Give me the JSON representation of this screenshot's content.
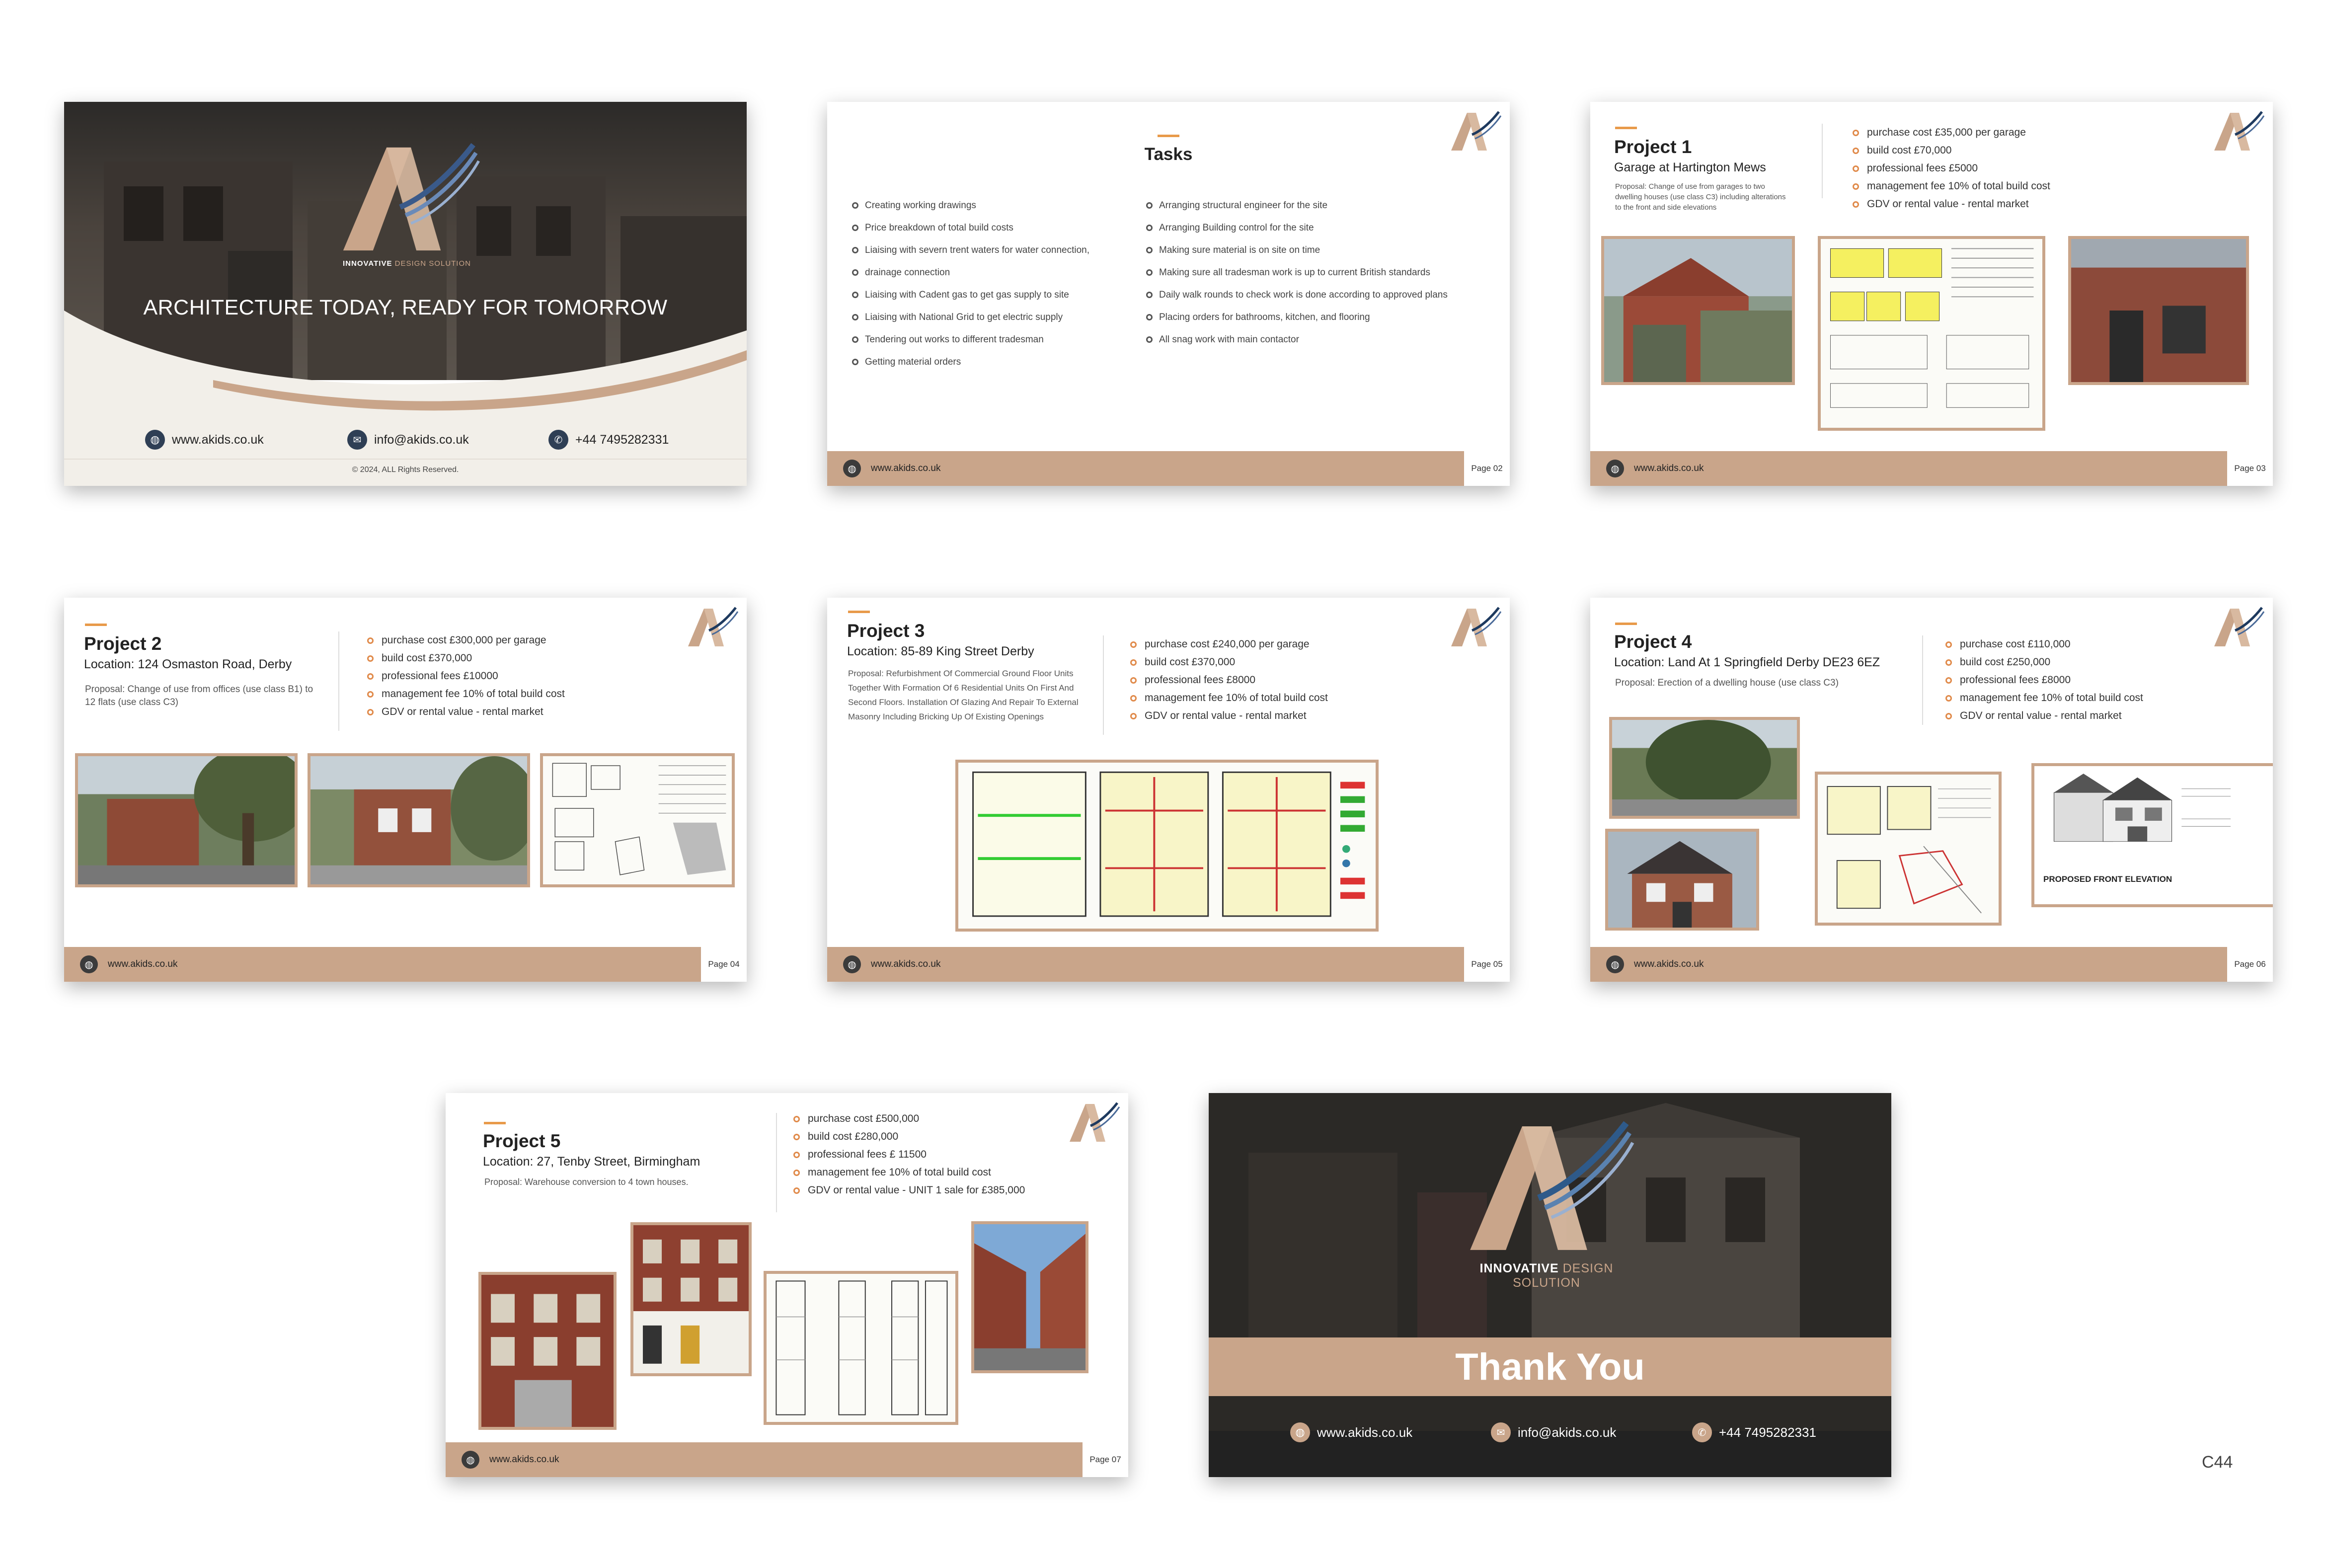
{
  "brand": {
    "name_a": "INNOVATIVE",
    "name_b": "DESIGN SOLUTION",
    "website": "www.akids.co.uk",
    "email": "info@akids.co.uk",
    "phone": "+44 7495282331",
    "colors": {
      "accent": "#c9a58a",
      "navy": "#1e3a5f",
      "orange": "#e89a4a"
    }
  },
  "cover": {
    "headline": "ARCHITECTURE TODAY, READY FOR TOMORROW",
    "copyright": "© 2024, ALL Rights Reserved."
  },
  "tasks": {
    "title": "Tasks",
    "page": "Page 02",
    "left": [
      "Creating working drawings",
      "Price breakdown of total build costs",
      "Liaising with severn trent waters for water connection,",
      "drainage connection",
      "Liaising with Cadent gas to get gas supply to site",
      "Liaising with National Grid to get electric supply",
      "Tendering out works to different tradesman",
      "Getting material orders"
    ],
    "right": [
      "Arranging structural engineer for the site",
      "Arranging Building control for the site",
      "Making sure material is on site on time",
      "Making sure all tradesman work is up to current British standards",
      "Daily walk rounds to check work is done according to approved plans",
      "Placing orders for bathrooms, kitchen, and flooring",
      "All snag work with main contactor"
    ]
  },
  "projects": [
    {
      "title": "Project 1",
      "subtitle": "Garage at Hartington Mews",
      "proposal": "Proposal: Change of use from garages to two dwelling houses (use class C3) including alterations to the front and side elevations",
      "bullets": [
        "purchase cost £35,000 per garage",
        "build cost £70,000",
        "professional fees £5000",
        "management fee 10% of total build cost",
        "GDV or rental value - rental market"
      ],
      "page": "Page 03"
    },
    {
      "title": "Project 2",
      "subtitle": "Location: 124 Osmaston Road, Derby",
      "proposal": "Proposal: Change of use from offices (use class B1) to 12 flats (use class C3)",
      "bullets": [
        "purchase cost £300,000 per garage",
        "build cost £370,000",
        "professional fees £10000",
        "management fee 10% of total build cost",
        "GDV or rental value - rental market"
      ],
      "page": "Page 04"
    },
    {
      "title": "Project 3",
      "subtitle": "Location: 85-89 King Street  Derby",
      "proposal": "Proposal: Refurbishment Of Commercial Ground Floor Units Together With Formation Of 6 Residential Units On First And Second Floors. Installation Of Glazing And Repair To External Masonry Including Bricking Up Of Existing Openings",
      "bullets": [
        "purchase cost £240,000 per garage",
        "build cost £370,000",
        "professional fees £8000",
        "management fee 10% of total build cost",
        "GDV or rental value - rental market"
      ],
      "page": "Page 05"
    },
    {
      "title": "Project 4",
      "subtitle": "Location: Land At 1 Springfield  Derby  DE23 6EZ",
      "proposal": "Proposal: Erection of a dwelling house (use class C3)",
      "bullets": [
        "purchase cost £110,000",
        "build cost £250,000",
        "professional fees £8000",
        "management fee 10% of total build cost",
        "GDV or rental value - rental market"
      ],
      "page": "Page 06",
      "elevation_label": "PROPOSED FRONT ELEVATION"
    },
    {
      "title": "Project 5",
      "subtitle": "Location: 27, Tenby Street, Birmingham",
      "proposal": "Proposal: Warehouse conversion to 4 town houses.",
      "bullets": [
        "purchase cost £500,000",
        "build cost £280,000",
        "professional fees £ 11500",
        "management fee 10% of total build cost",
        "GDV or rental value - UNIT 1 sale for £385,000"
      ],
      "page": "Page 07"
    }
  ],
  "closing": {
    "title": "Thank You"
  },
  "sheet_code": "C44",
  "icons": [
    "globe-icon",
    "mail-icon",
    "phone-icon",
    "bullet-circle-icon",
    "ak-logo"
  ]
}
